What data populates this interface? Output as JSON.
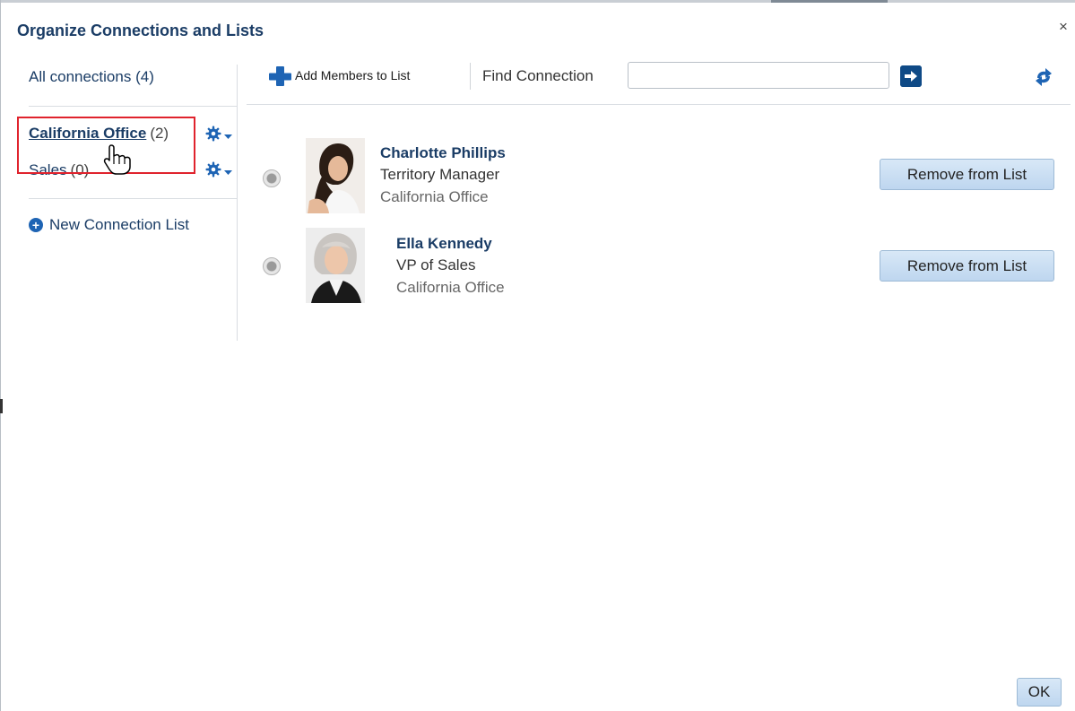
{
  "dialog": {
    "title": "Organize Connections and Lists",
    "close_glyph": "×"
  },
  "sidebar": {
    "all_connections": {
      "label": "All connections",
      "count": "(4)"
    },
    "lists": [
      {
        "label": "California Office",
        "count": "(2)",
        "selected": true
      },
      {
        "label": "Sales",
        "count": "(0)",
        "selected": false
      }
    ],
    "new_list_label": "New Connection List"
  },
  "toolbar": {
    "add_members_label": "Add Members to List",
    "find_label": "Find Connection",
    "find_value": ""
  },
  "members": [
    {
      "name": "Charlotte Phillips",
      "title": "Territory Manager",
      "location": "California Office",
      "action_label": "Remove from List"
    },
    {
      "name": "Ella Kennedy",
      "title": "VP of Sales",
      "location": "California Office",
      "action_label": "Remove from List"
    }
  ],
  "footer": {
    "ok_label": "OK"
  },
  "colors": {
    "accent": "#1e64b4",
    "link": "#1b3d66",
    "highlight": "#e0232d",
    "button": "#bed6ef"
  },
  "icons": [
    "close-icon",
    "gear-icon",
    "chevron-down-icon",
    "plus-icon",
    "arrow-right-icon",
    "refresh-icon",
    "hand-cursor-icon"
  ]
}
